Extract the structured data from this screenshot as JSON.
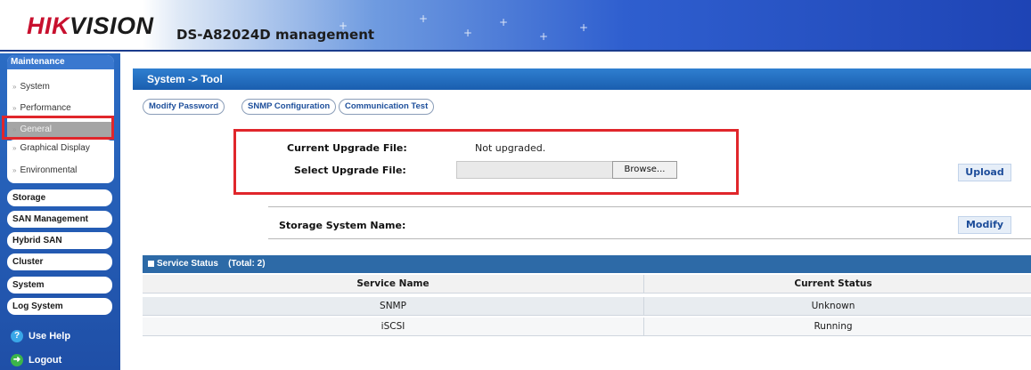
{
  "header": {
    "brand_red": "HIK",
    "brand_dark": "VISION",
    "model_title": "DS-A82024D management"
  },
  "sidebar": {
    "group_title": "Maintenance",
    "subitems": [
      "System",
      "Performance",
      "General",
      "Graphical Display",
      "Environmental"
    ],
    "active_subitem": "General",
    "buttons": [
      "Storage",
      "SAN Management",
      "Hybrid SAN",
      "Cluster",
      "System",
      "Log System"
    ],
    "help_label": "Use Help",
    "logout_label": "Logout"
  },
  "main": {
    "title": "System -> Tool",
    "tabs": [
      "Modify Password",
      "SNMP Configuration",
      "Communication Test"
    ],
    "upgrade": {
      "current_label": "Current Upgrade File:",
      "current_value": "Not upgraded.",
      "select_label": "Select Upgrade File:",
      "browse_label": "Browse...",
      "upload_label": "Upload"
    },
    "storage": {
      "name_label": "Storage System Name:",
      "modify_label": "Modify"
    },
    "service_status": {
      "title": "Service Status",
      "total": "(Total: 2)",
      "columns": [
        "Service Name",
        "Current Status"
      ],
      "rows": [
        {
          "name": "SNMP",
          "status": "Unknown"
        },
        {
          "name": "iSCSI",
          "status": "Running"
        }
      ]
    }
  },
  "colors": {
    "brand_red": "#c8102e",
    "sidebar_blue": "#2b6cc4",
    "title_bar": "#2f7fd0",
    "highlight_red": "#e0262b"
  }
}
